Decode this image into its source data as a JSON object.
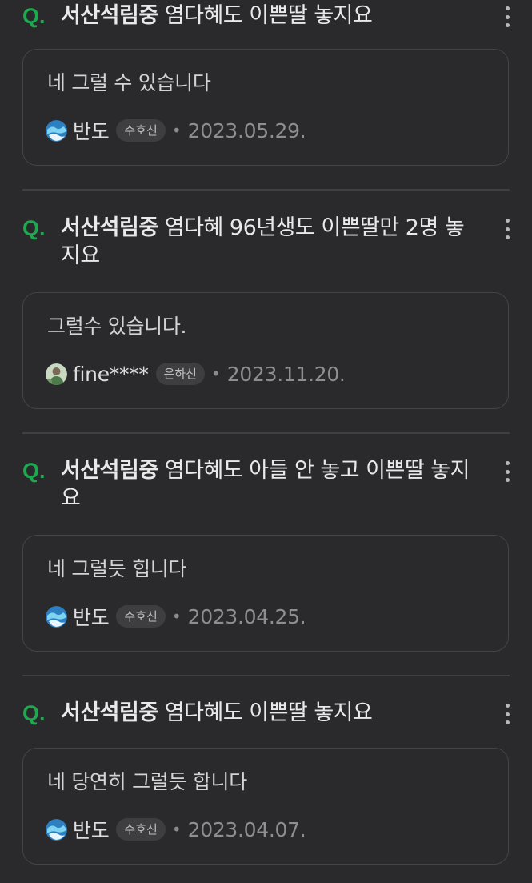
{
  "items": [
    {
      "question": {
        "school": "서산석림중",
        "text": "염다혜도 이쁜딸 놓지요"
      },
      "answer": {
        "text": "네 그럴 수 있습니다",
        "user": "반도",
        "badge": "수호신",
        "separator": "•",
        "date": "2023.05.29.",
        "avatar": "globe-avatar"
      }
    },
    {
      "question": {
        "school": "서산석림중",
        "text": "염다혜 96년생도 이쁜딸만 2명 놓지요"
      },
      "answer": {
        "text": "그럴수 있습니다.",
        "user": "fine****",
        "badge": "은하신",
        "separator": "•",
        "date": "2023.11.20.",
        "avatar": "person-avatar"
      }
    },
    {
      "question": {
        "school": "서산석림중",
        "text": "염다혜도 아들 안 놓고 이쁜딸 놓지요"
      },
      "answer": {
        "text": "네 그럴듯 힙니다",
        "user": "반도",
        "badge": "수호신",
        "separator": "•",
        "date": "2023.04.25.",
        "avatar": "globe-avatar"
      }
    },
    {
      "question": {
        "school": "서산석림중",
        "text": "염다혜도 이쁜딸 놓지요"
      },
      "answer": {
        "text": "네 당연히 그럴듯 합니다",
        "user": "반도",
        "badge": "수호신",
        "separator": "•",
        "date": "2023.04.07.",
        "avatar": "globe-avatar"
      }
    }
  ],
  "labels": {
    "question_mark": "Q."
  },
  "colors": {
    "accent": "#1ea84f",
    "background": "#2a2a2c",
    "card_border": "#444447"
  }
}
